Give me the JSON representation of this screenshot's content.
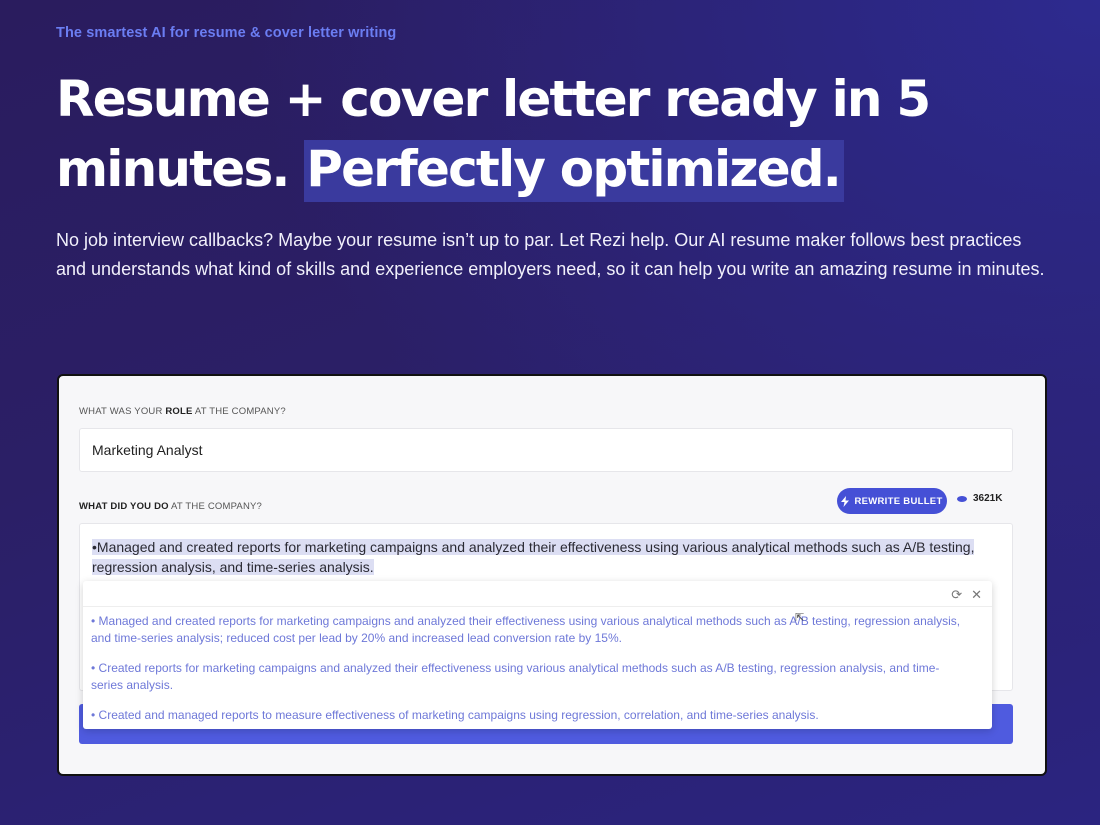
{
  "hero": {
    "tagline": "The smartest AI for resume & cover letter writing",
    "headline_part1": "Resume + cover letter ready in 5 minutes.",
    "headline_highlight": "Perfectly optimized.",
    "lead": "No job interview callbacks? Maybe your resume isn’t up to par. Let Rezi help. Our AI resume maker follows best practices and understands what kind of skills and experience employers need, so it can help you write an amazing resume in minutes."
  },
  "form": {
    "role_label_pre": "WHAT WAS YOUR ",
    "role_label_bold": "ROLE",
    "role_label_post": " AT THE COMPANY?",
    "role_value": "Marketing Analyst",
    "do_label_bold": "WHAT DID YOU DO",
    "do_label_post": " AT THE COMPANY?",
    "rewrite_label": "REWRITE BULLET",
    "credits": "3621K",
    "do_value": "•Managed and created reports for marketing campaigns and analyzed their effectiveness using various analytical methods such as A/B testing, regression analysis, and time-series analysis."
  },
  "suggestions": [
    "• Managed and created reports for marketing campaigns and analyzed their effectiveness using various analytical methods such as A/B testing, regression analysis, and time-series analysis; reduced cost per lead by 20% and increased lead conversion rate by 15%.",
    "• Created reports for marketing campaigns and analyzed their effectiveness using various analytical methods such as A/B testing, regression analysis, and time-series analysis.",
    "• Created and managed reports to measure effectiveness of marketing campaigns using regression, correlation, and time-series analysis."
  ],
  "icons": {
    "refresh": "refresh-icon",
    "close": "close-icon",
    "bolt": "bolt-icon",
    "coin": "coin-icon"
  }
}
